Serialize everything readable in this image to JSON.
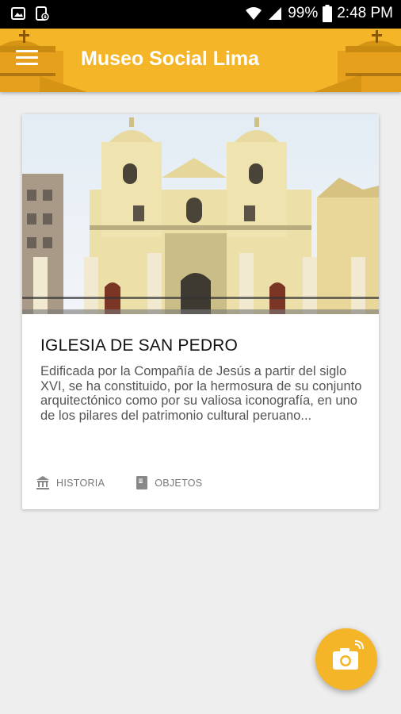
{
  "status_bar": {
    "battery_percent": "99%",
    "time": "2:48 PM",
    "icons": [
      "gallery-icon",
      "download-icon",
      "wifi-icon",
      "signal-icon",
      "battery-icon"
    ]
  },
  "app_bar": {
    "title": "Museo Social Lima",
    "menu_icon": "hamburger-menu-icon",
    "background_color": "#f5b529"
  },
  "card": {
    "image_alt": "church-facade-photo",
    "title": "IGLESIA DE SAN PEDRO",
    "description": "Edificada por la Compañía de Jesús a partir del siglo XVI, se ha constituido, por la hermosura de su conjunto arquitectónico como por su valiosa iconografía, en uno de los pilares del patrimonio cultural peruano...",
    "actions": [
      {
        "label": "HISTORIA",
        "icon": "museum-icon"
      },
      {
        "label": "OBJETOS",
        "icon": "book-icon"
      }
    ]
  },
  "fab": {
    "icon": "camera-icon",
    "color": "#f5b529"
  }
}
